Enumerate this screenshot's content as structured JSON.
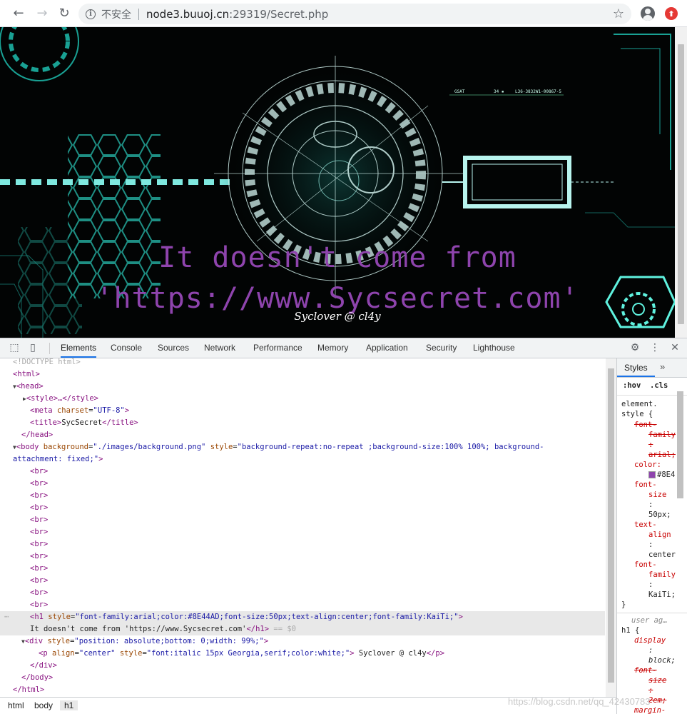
{
  "browser": {
    "security_label": "不安全",
    "url_host": "node3.buuoj.cn",
    "url_rest": ":29319/Secret.php"
  },
  "page": {
    "heading_line1": "It doesn't come from",
    "heading_line2": "'https://www.Sycsecret.com'",
    "heading_color": "#8E44AD",
    "signature": "Syclover @ cl4y",
    "hud_labels": [
      "GSAT",
      "34 ▪",
      "L36-3832W1-00867-5"
    ]
  },
  "devtools": {
    "tabs": [
      "Elements",
      "Console",
      "Sources",
      "Network",
      "Performance",
      "Memory",
      "Application",
      "Security",
      "Lighthouse"
    ],
    "active_tab": "Elements",
    "dom": {
      "doctype": "<!DOCTYPE html>",
      "html_open": "<html>",
      "head_open": "<head>",
      "style_line": "<style>…</style>",
      "meta_tag": "meta",
      "meta_attr": "charset",
      "meta_val": "\"UTF-8\"",
      "title_open": "<title>",
      "title_text": "SycSecret",
      "title_close": "</title>",
      "head_close": "</head>",
      "body_tag": "<body",
      "body_attr1": "background",
      "body_val1": "\"./images/background.png\"",
      "body_attr2": "style",
      "body_val2a": "\"background-repeat:no-repeat ;background-size:100% 100%; background-",
      "body_val2b": "attachment: fixed;\"",
      "br": "<br>",
      "h1_tag": "<h1",
      "h1_attr": "style",
      "h1_val": "\"font-family:arial;color:#8E44AD;font-size:50px;text-align:center;font-family:KaiTi;\"",
      "h1_text": "It doesn't come from 'https://www.Sycsecret.com'",
      "h1_close": "</h1>",
      "h1_marker": "== $0",
      "div_tag": "<div",
      "div_attr": "style",
      "div_val": "\"position: absolute;bottom: 0;width: 99%;\"",
      "p_tag": "<p",
      "p_attr1": "align",
      "p_val1": "\"center\"",
      "p_attr2": "style",
      "p_val2": "\"font:italic 15px Georgia,serif;color:white;\"",
      "p_text": "Syclover @ cl4y",
      "p_close": "</p>",
      "div_close": "</div>",
      "body_close": "</body>",
      "html_close": "</html>"
    },
    "breadcrumbs": [
      "html",
      "body",
      "h1"
    ],
    "styles": {
      "tab": "Styles",
      "hov": ":hov",
      "cls": ".cls",
      "lines": [
        "element.",
        "style {",
        "font-",
        "family",
        ":",
        "arial;",
        "color:",
        "#8E4",
        "font-",
        "size",
        ":",
        "50px;",
        "text-",
        "align",
        ":",
        "center",
        "font-",
        "family",
        ":",
        "KaiTi;",
        "}"
      ],
      "ua_label": "user ag…",
      "ua_lines": [
        "h1 {",
        "display",
        ":",
        "block;",
        "font-",
        "size",
        ":",
        "2em;",
        "margin-"
      ]
    }
  },
  "watermark": "https://blog.csdn.net/qq_42430783"
}
